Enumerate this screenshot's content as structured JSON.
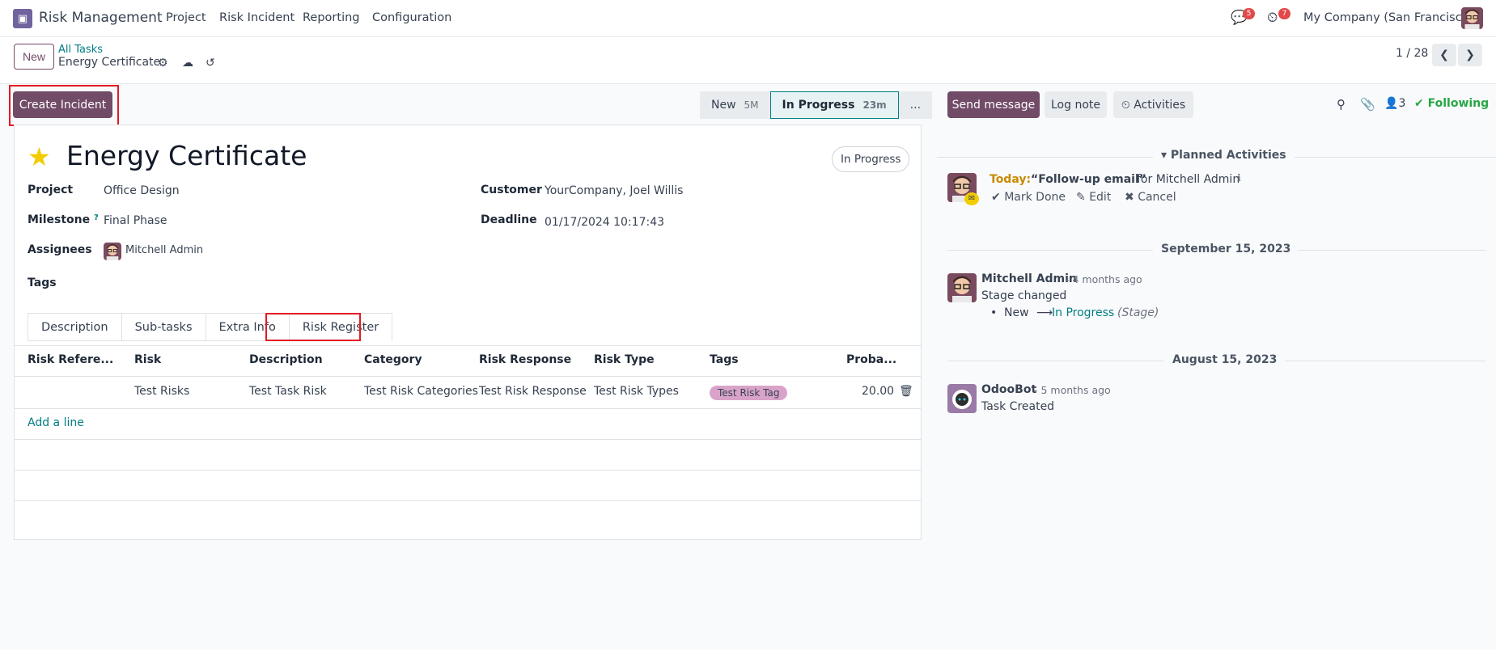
{
  "topbar": {
    "app_name": "Risk Management",
    "menu": [
      "Project",
      "Risk Incident",
      "Reporting",
      "Configuration"
    ],
    "messages_badge": "5",
    "activities_badge": "7",
    "company": "My Company (San Francisco)"
  },
  "control_panel": {
    "new_label": "New",
    "breadcrumb_parent": "All Tasks",
    "breadcrumb_current": "Energy Certificate",
    "pager": "1 / 28"
  },
  "actions": {
    "create_incident": "Create Incident"
  },
  "stages": [
    {
      "label": "New",
      "time": "5M"
    },
    {
      "label": "In Progress",
      "time": "23m"
    },
    {
      "label": "..."
    }
  ],
  "record": {
    "title": "Energy Certificate",
    "status": "In Progress",
    "fields": {
      "project_label": "Project",
      "project_value": "Office Design",
      "milestone_label": "Milestone",
      "milestone_help": "?",
      "milestone_value": "Final Phase",
      "assignees_label": "Assignees",
      "assignees_value": "Mitchell Admin",
      "tags_label": "Tags",
      "customer_label": "Customer",
      "customer_value": "YourCompany, Joel Willis",
      "deadline_label": "Deadline",
      "deadline_value": "01/17/2024 10:17:43"
    }
  },
  "tabs": [
    "Description",
    "Sub-tasks",
    "Extra Info",
    "Risk Register"
  ],
  "risk_table": {
    "columns": [
      "Risk Refere...",
      "Risk",
      "Description",
      "Category",
      "Risk Response",
      "Risk Type",
      "Tags",
      "Proba..."
    ],
    "rows": [
      {
        "ref": "",
        "risk": "Test Risks",
        "description": "Test Task Risk",
        "category": "Test Risk Categories",
        "response": "Test Risk Response",
        "type": "Test Risk Types",
        "tag": "Test Risk Tag",
        "probability": "20.00"
      }
    ],
    "add_line": "Add a line"
  },
  "chatter": {
    "send_message": "Send message",
    "log_note": "Log note",
    "activities": "Activities",
    "followers_count": "3",
    "following": "Following",
    "planned_activities": "Planned Activities",
    "activity": {
      "when": "Today:",
      "summary": "“Follow-up email”",
      "for": "for Mitchell Admin",
      "mark_done": "Mark Done",
      "edit": "Edit",
      "cancel": "Cancel"
    },
    "date1": "September 15, 2023",
    "msg1": {
      "author": "Mitchell Admin",
      "ago": "- 4 months ago",
      "body": "Stage changed",
      "from": "New",
      "to": "In Progress",
      "field": "(Stage)"
    },
    "date2": "August 15, 2023",
    "msg2": {
      "author": "OdooBot",
      "ago": "- 5 months ago",
      "body": "Task Created"
    }
  },
  "colors": {
    "brand": "#714b67",
    "link": "#017e84",
    "highlight": "#e31b23",
    "following": "#28a745",
    "tag": "#d9a3c9"
  }
}
